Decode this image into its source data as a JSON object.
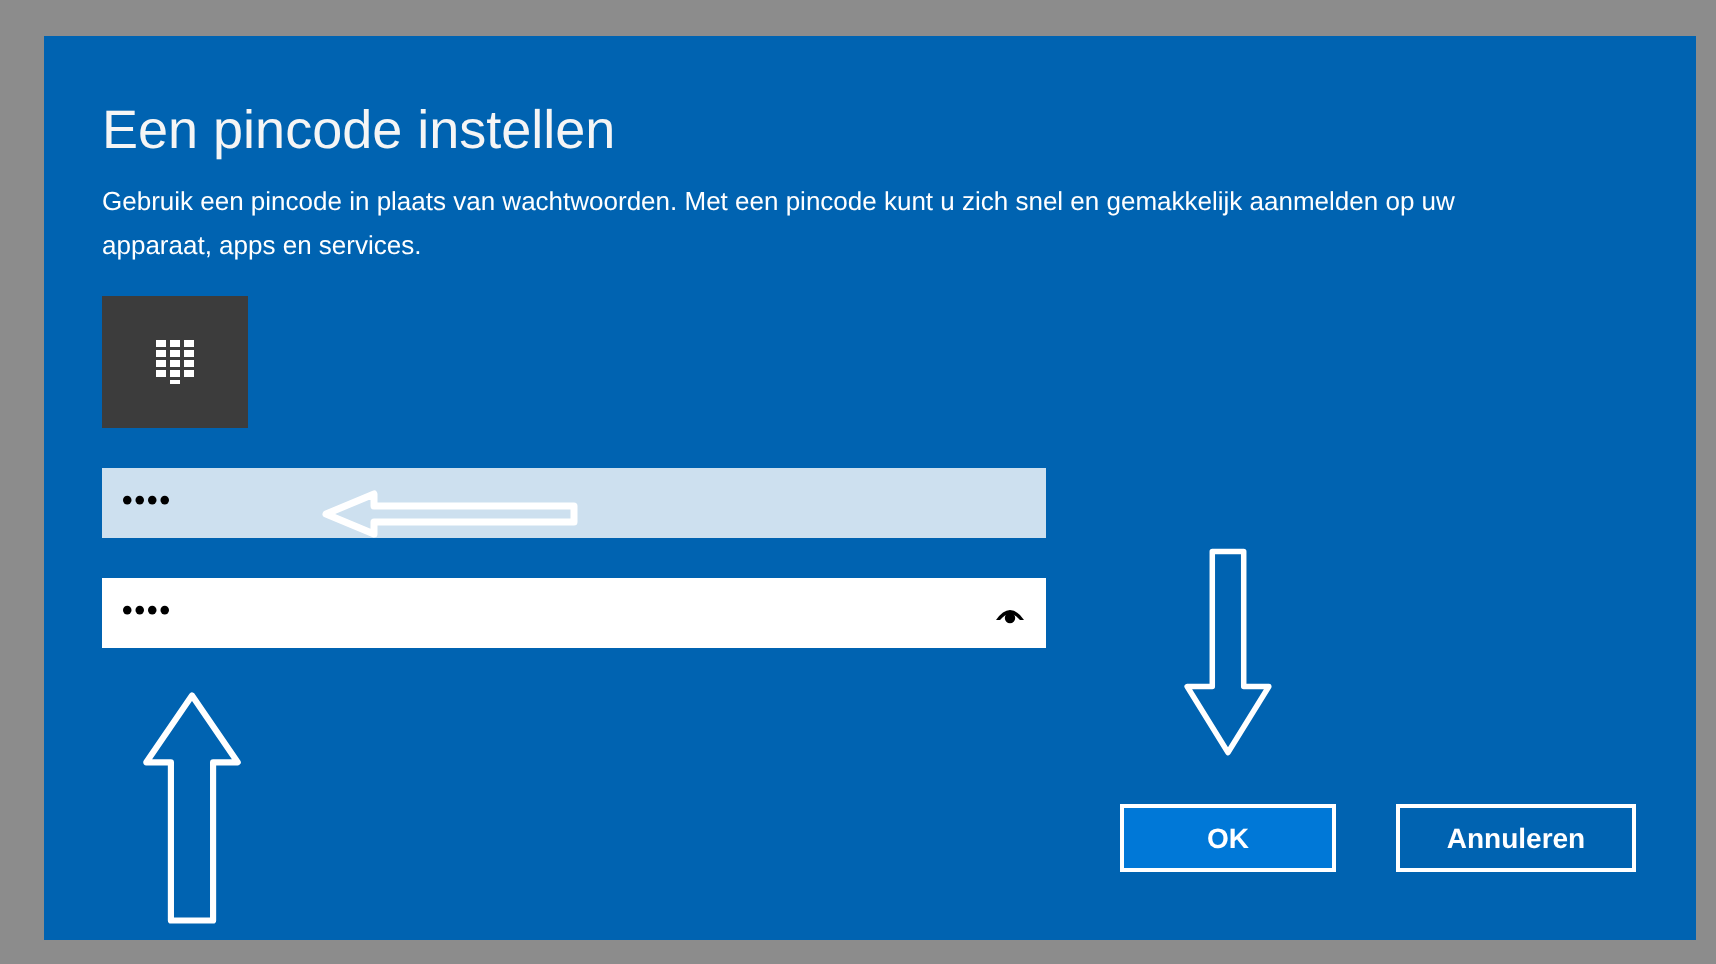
{
  "dialog": {
    "title": "Een pincode instellen",
    "description": "Gebruik een pincode in plaats van wachtwoorden. Met een pincode kunt u zich snel en gemakkelijk aanmelden op uw apparaat, apps en services."
  },
  "fields": [
    {
      "value": "••••",
      "focused": false
    },
    {
      "value": "••••",
      "focused": true
    }
  ],
  "buttons": [
    {
      "label": "OK",
      "primary": true
    },
    {
      "label": "Annuleren",
      "primary": false
    }
  ]
}
